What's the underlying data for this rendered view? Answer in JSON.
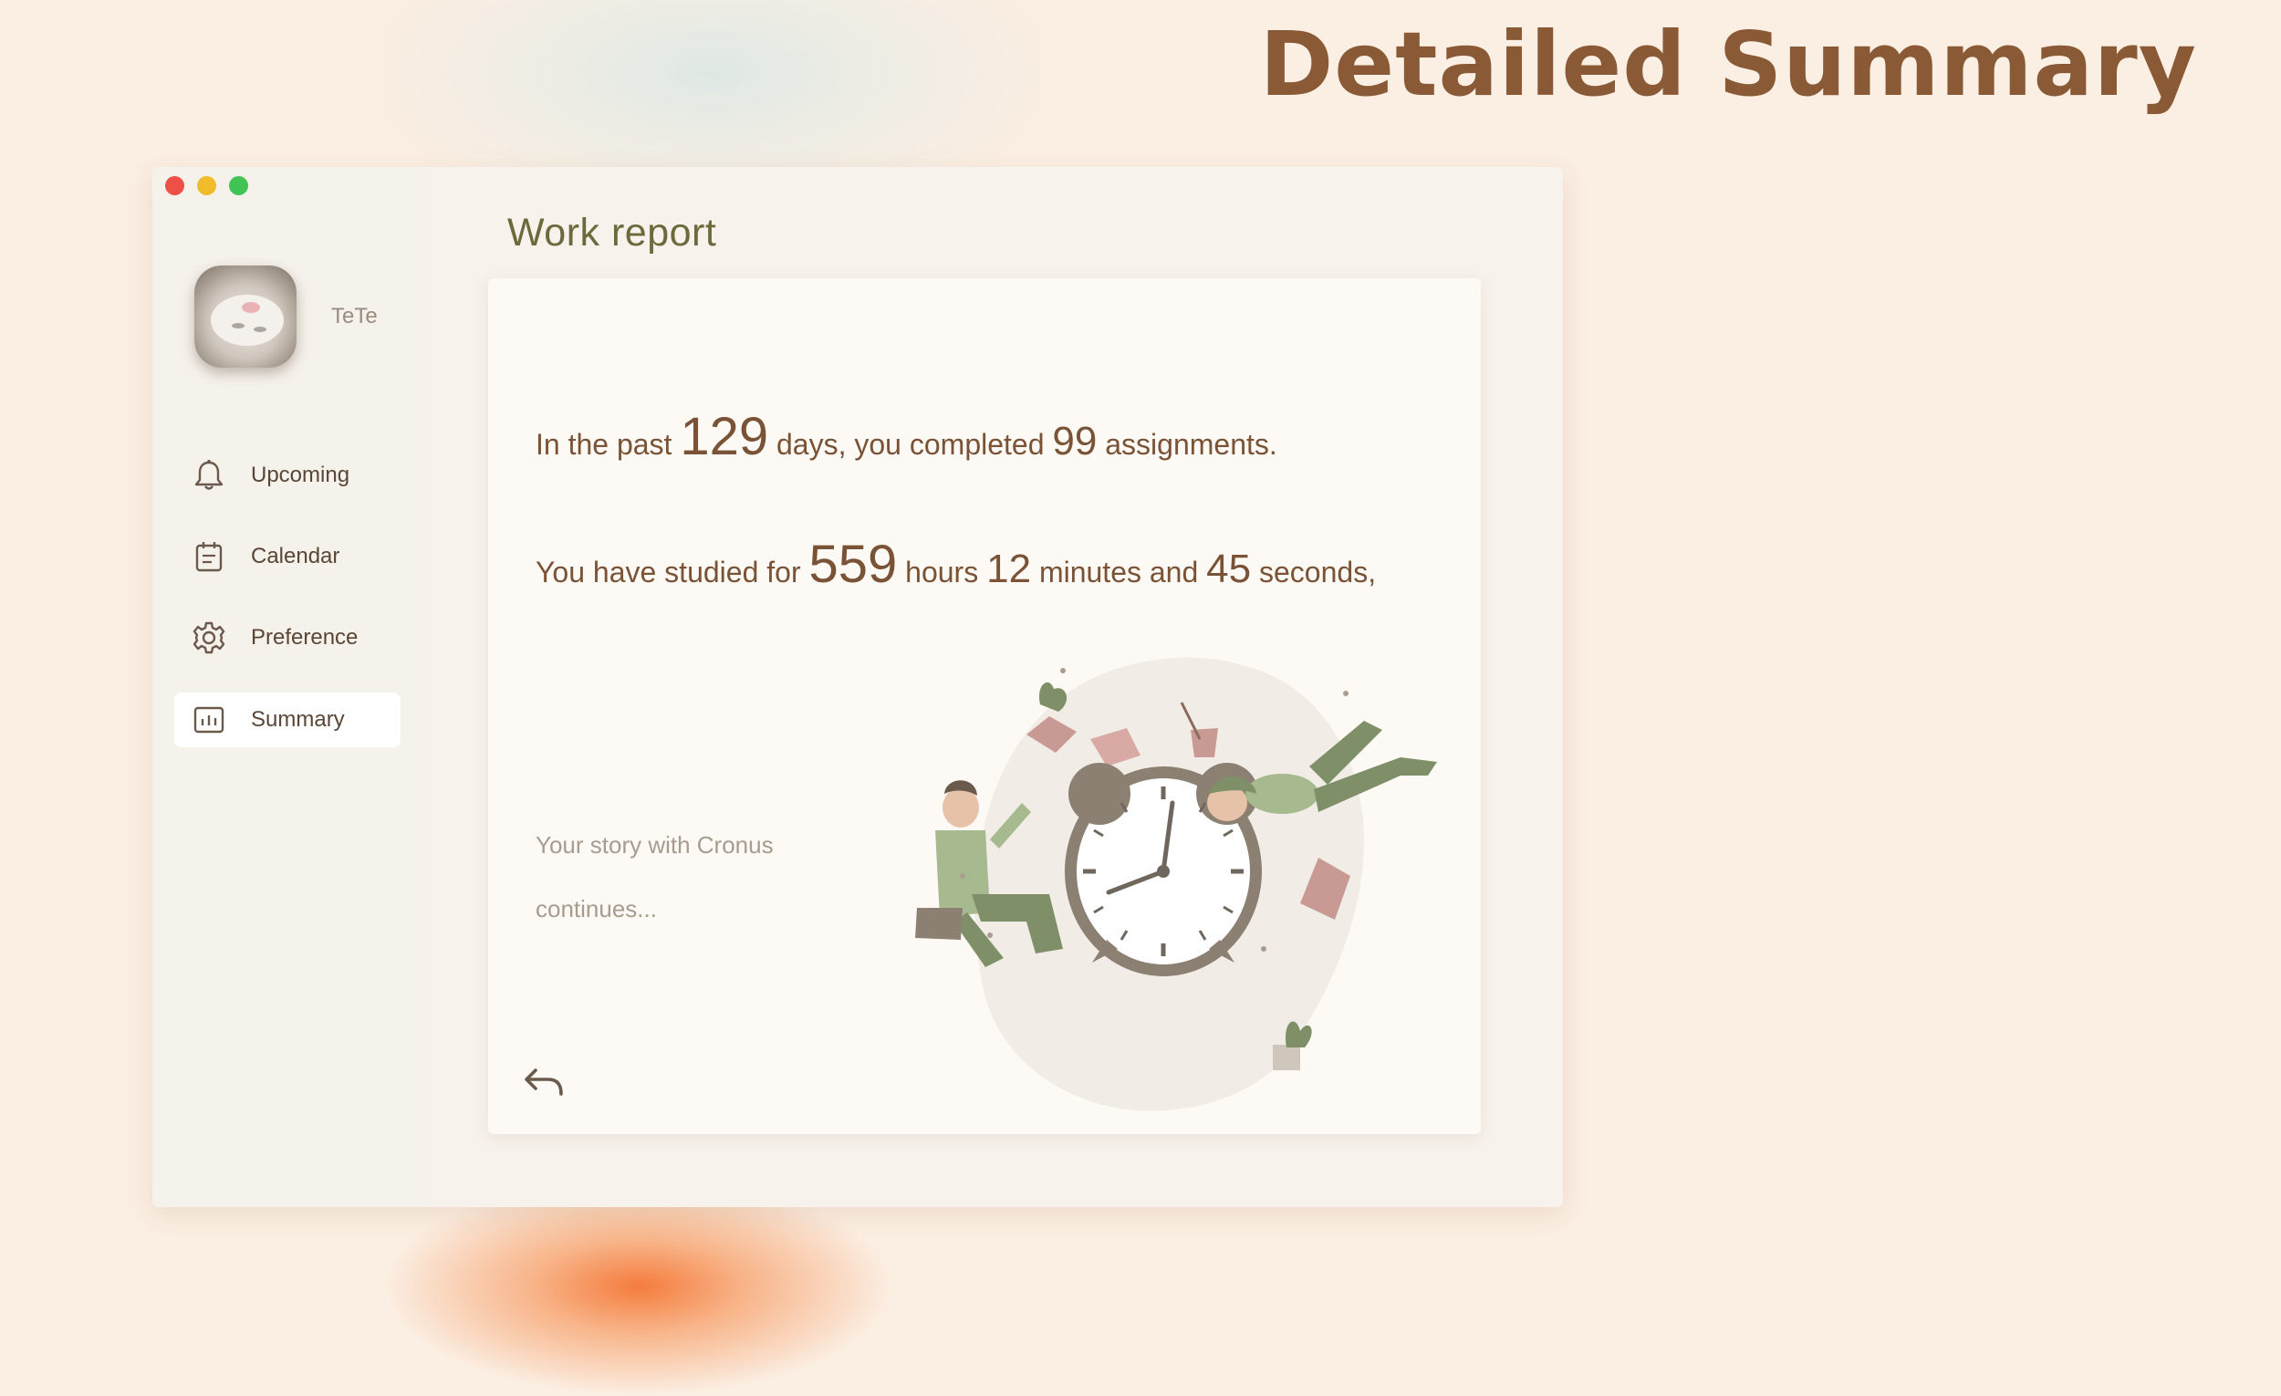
{
  "promo": {
    "title": "Detailed Summary"
  },
  "window": {
    "traffic_lights": [
      "close",
      "minimize",
      "zoom"
    ]
  },
  "profile": {
    "username": "TeTe"
  },
  "sidebar": {
    "items": [
      {
        "label": "Upcoming",
        "icon": "bell-icon"
      },
      {
        "label": "Calendar",
        "icon": "calendar-icon"
      },
      {
        "label": "Preference",
        "icon": "gear-icon"
      },
      {
        "label": "Summary",
        "icon": "chart-icon",
        "active": true
      }
    ]
  },
  "report": {
    "title": "Work report",
    "line1": {
      "pre": "In the past",
      "days": "129",
      "mid": "days, you completed",
      "assignments": "99",
      "post": "assignments."
    },
    "line2": {
      "pre": "You have studied for",
      "hours": "559",
      "hours_label": "hours",
      "minutes": "12",
      "minutes_label": "minutes and",
      "seconds": "45",
      "seconds_label": "seconds,"
    },
    "story_line1": "Your story with Cronus",
    "story_line2": "continues..."
  },
  "colors": {
    "accent_brown": "#8a5a36",
    "text_brown": "#7a5235",
    "olive": "#6b6a3c",
    "illustration_green": "#8a9a72",
    "illustration_pink": "#c99a94"
  }
}
